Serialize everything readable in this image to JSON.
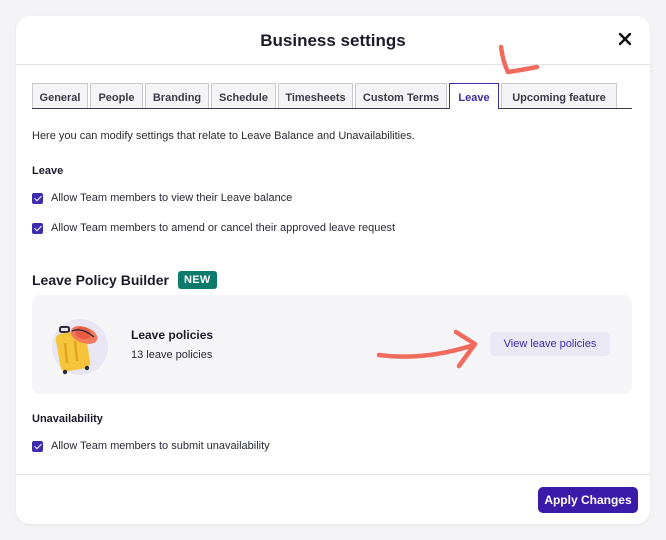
{
  "modal": {
    "title": "Business settings"
  },
  "tabs": [
    {
      "label": "General",
      "active": false
    },
    {
      "label": "People",
      "active": false
    },
    {
      "label": "Branding",
      "active": false
    },
    {
      "label": "Schedule",
      "active": false
    },
    {
      "label": "Timesheets",
      "active": false
    },
    {
      "label": "Custom Terms",
      "active": false
    },
    {
      "label": "Leave",
      "active": true
    },
    {
      "label": "Upcoming feature",
      "active": false
    }
  ],
  "intro": "Here you can modify settings that relate to Leave Balance and Unavailabilities.",
  "leave_section": {
    "label": "Leave",
    "options": [
      {
        "label": "Allow Team members to view their Leave balance",
        "checked": true
      },
      {
        "label": "Allow Team members to amend or cancel their approved leave request",
        "checked": true
      }
    ]
  },
  "builder": {
    "title": "Leave Policy Builder",
    "badge": "NEW",
    "card": {
      "name": "Leave policies",
      "count": "13 leave policies",
      "button": "View leave policies"
    }
  },
  "unavailability_section": {
    "label": "Unavailability",
    "options": [
      {
        "label": "Allow Team members to submit unavailability",
        "checked": true
      }
    ]
  },
  "footer": {
    "apply_label": "Apply Changes"
  },
  "colors": {
    "accent": "#3a1aa8",
    "badge": "#0e7a6c",
    "annotation": "#f06b5e"
  },
  "icons": {
    "close": "close-icon",
    "suitcase": "suitcase-illustration",
    "check": "check-icon"
  }
}
